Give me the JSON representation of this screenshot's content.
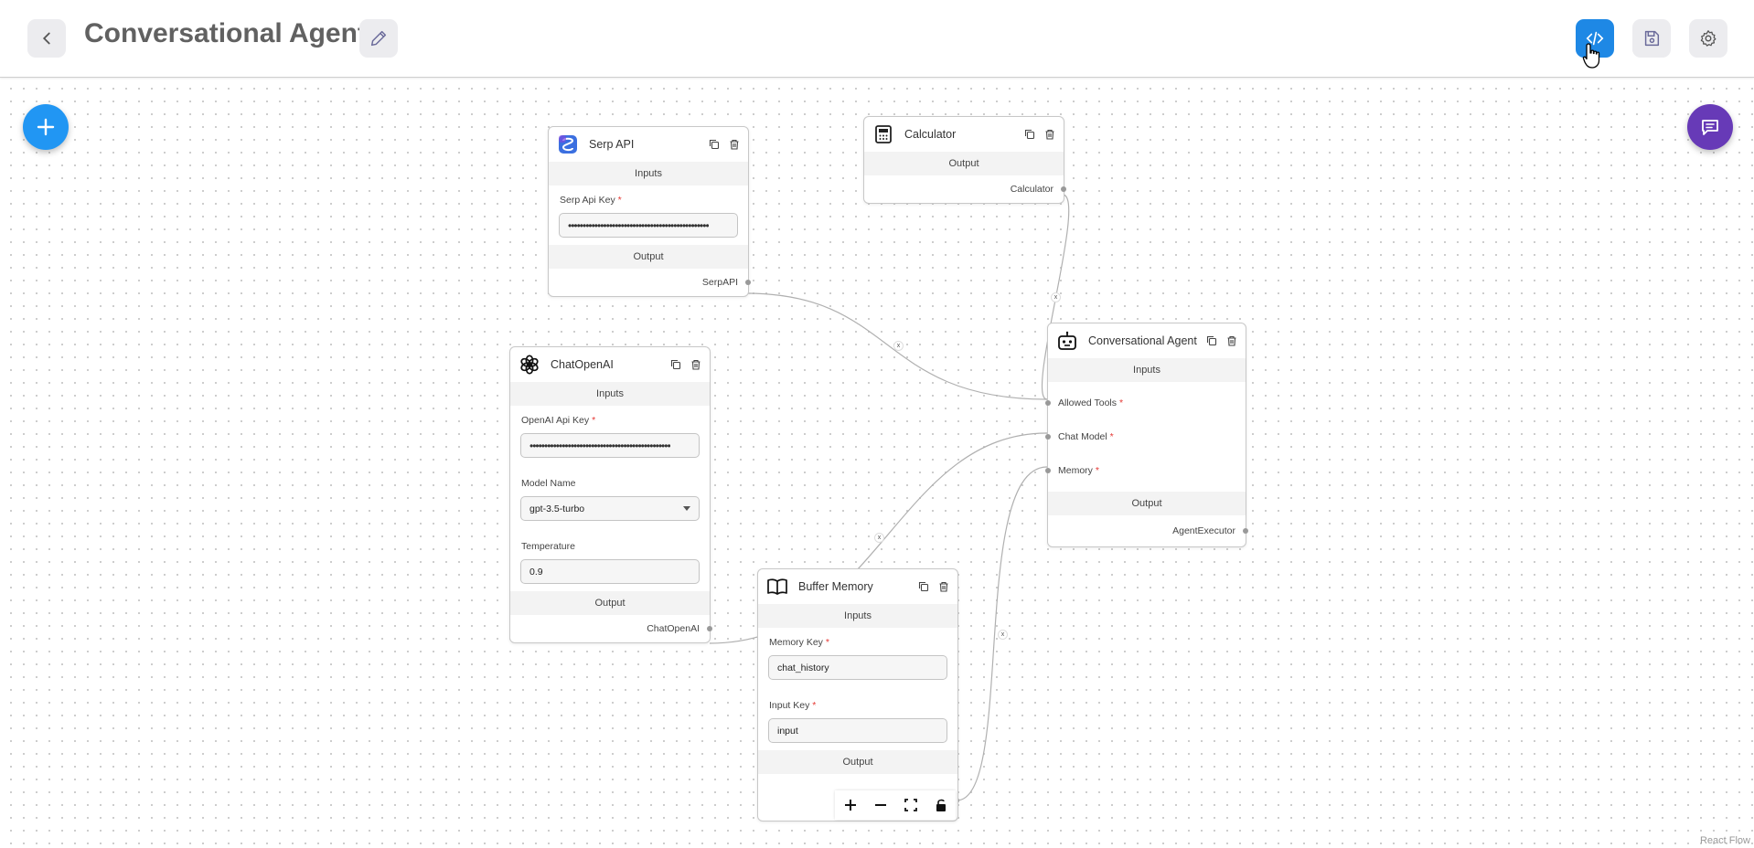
{
  "header": {
    "title": "Conversational Agent",
    "accent": "#1e88e5"
  },
  "nodes": {
    "serp": {
      "title": "Serp API",
      "inputs_label": "Inputs",
      "api_key_label": "Serp Api Key",
      "api_key_value": "••••••••••••••••••••••••••••••••••••••••••••••••",
      "output_label": "Output",
      "output_name": "SerpAPI"
    },
    "calculator": {
      "title": "Calculator",
      "output_label": "Output",
      "output_name": "Calculator"
    },
    "chat_openai": {
      "title": "ChatOpenAI",
      "inputs_label": "Inputs",
      "api_key_label": "OpenAI Api Key",
      "api_key_value": "••••••••••••••••••••••••••••••••••••••••••••••••",
      "model_label": "Model Name",
      "model_value": "gpt-3.5-turbo",
      "temp_label": "Temperature",
      "temp_value": "0.9",
      "output_label": "Output",
      "output_name": "ChatOpenAI"
    },
    "buffer_memory": {
      "title": "Buffer Memory",
      "inputs_label": "Inputs",
      "memory_key_label": "Memory Key",
      "memory_key_value": "chat_history",
      "input_key_label": "Input Key",
      "input_key_value": "input",
      "output_label": "Output"
    },
    "agent": {
      "title": "Conversational Agent",
      "inputs_label": "Inputs",
      "tools_label": "Allowed Tools",
      "model_label": "Chat Model",
      "memory_label": "Memory",
      "output_label": "Output",
      "output_name": "AgentExecutor"
    }
  },
  "edge_delete_glyph": "x",
  "required_mark": "*",
  "attribution": "React Flow",
  "icons": [
    "back-icon",
    "edit-icon",
    "code-icon",
    "save-icon",
    "settings-icon",
    "plus-icon",
    "chat-icon",
    "copy-icon",
    "trash-icon",
    "zoom-in-icon",
    "zoom-out-icon",
    "fit-view-icon",
    "lock-icon"
  ]
}
